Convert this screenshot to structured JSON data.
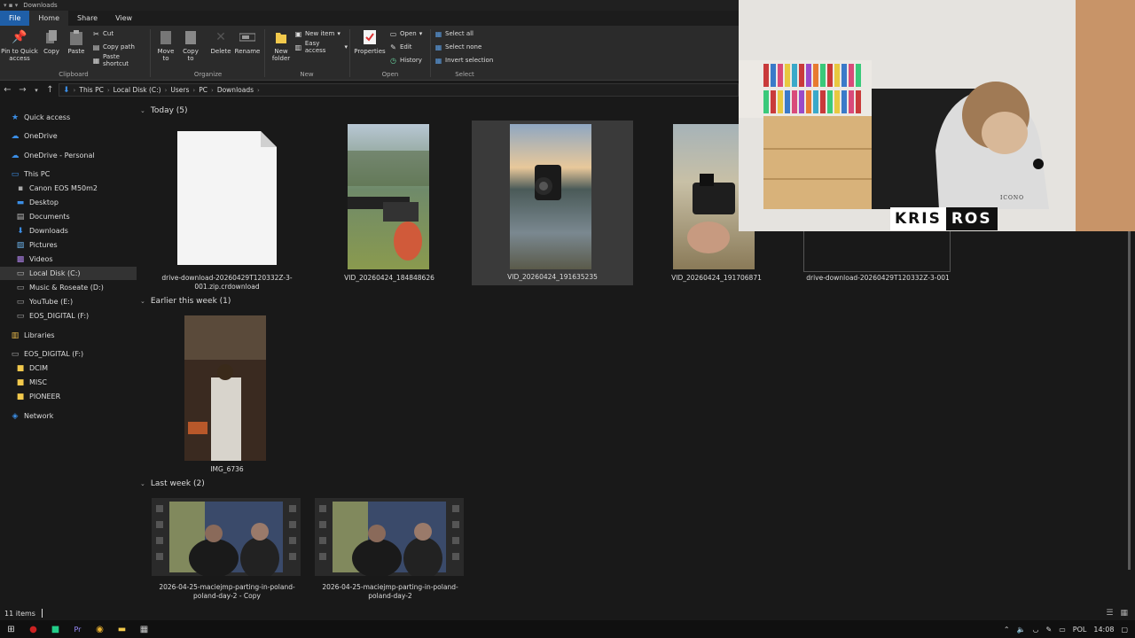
{
  "window": {
    "title": "Downloads"
  },
  "tabs": [
    "File",
    "Home",
    "Share",
    "View"
  ],
  "ribbon": {
    "clipboard": {
      "pin": "Pin to Quick\naccess",
      "copy": "Copy",
      "paste": "Paste",
      "cut": "Cut",
      "copy_path": "Copy path",
      "paste_shortcut": "Paste shortcut",
      "label": "Clipboard"
    },
    "organize": {
      "move_to": "Move\nto",
      "copy_to": "Copy\nto",
      "delete": "Delete",
      "rename": "Rename",
      "label": "Organize"
    },
    "new": {
      "new_folder": "New\nfolder",
      "new_item": "New item",
      "easy_access": "Easy access",
      "label": "New"
    },
    "open": {
      "properties": "Properties",
      "open": "Open",
      "edit": "Edit",
      "history": "History",
      "label": "Open"
    },
    "select": {
      "select_all": "Select all",
      "select_none": "Select none",
      "invert": "Invert selection",
      "label": "Select"
    }
  },
  "address": {
    "crumbs": [
      "This PC",
      "Local Disk (C:)",
      "Users",
      "PC",
      "Downloads"
    ]
  },
  "nav": {
    "quick_access": "Quick access",
    "onedrive": "OneDrive",
    "onedrive_personal": "OneDrive - Personal",
    "this_pc": "This PC",
    "canon": "Canon EOS M50m2",
    "desktop": "Desktop",
    "documents": "Documents",
    "downloads": "Downloads",
    "pictures": "Pictures",
    "videos": "Videos",
    "local_disk": "Local Disk (C:)",
    "music": "Music & Roseate (D:)",
    "youtube": "YouTube (E:)",
    "eos1": "EOS_DIGITAL (F:)",
    "libraries": "Libraries",
    "eos2": "EOS_DIGITAL (F:)",
    "dcim": "DCIM",
    "misc": "MISC",
    "pioneer": "PIONEER",
    "network": "Network"
  },
  "sections": {
    "today": "Today (5)",
    "earlier": "Earlier this week (1)",
    "last_week": "Last week (2)"
  },
  "files": {
    "f1": "drive-download-20260429T120332Z-3-001.zip.crdownload",
    "f2": "VID_20260424_184848626",
    "f3": "VID_20260424_191635235",
    "f4": "VID_20260424_191706871",
    "f5": "drive-download-20260429T120332Z-3-001",
    "f6": "IMG_6736",
    "f7": "2026-04-25-maciejmp-parting-in-poland-poland-day-2 - Copy",
    "f8": "2026-04-25-maciejmp-parting-in-poland-poland-day-2"
  },
  "status": {
    "count": "11 items"
  },
  "tray": {
    "lang": "POL",
    "time": "14:08"
  },
  "overlay": {
    "left": "KRIS",
    "right": "ROS",
    "shirt": "ICONO"
  }
}
